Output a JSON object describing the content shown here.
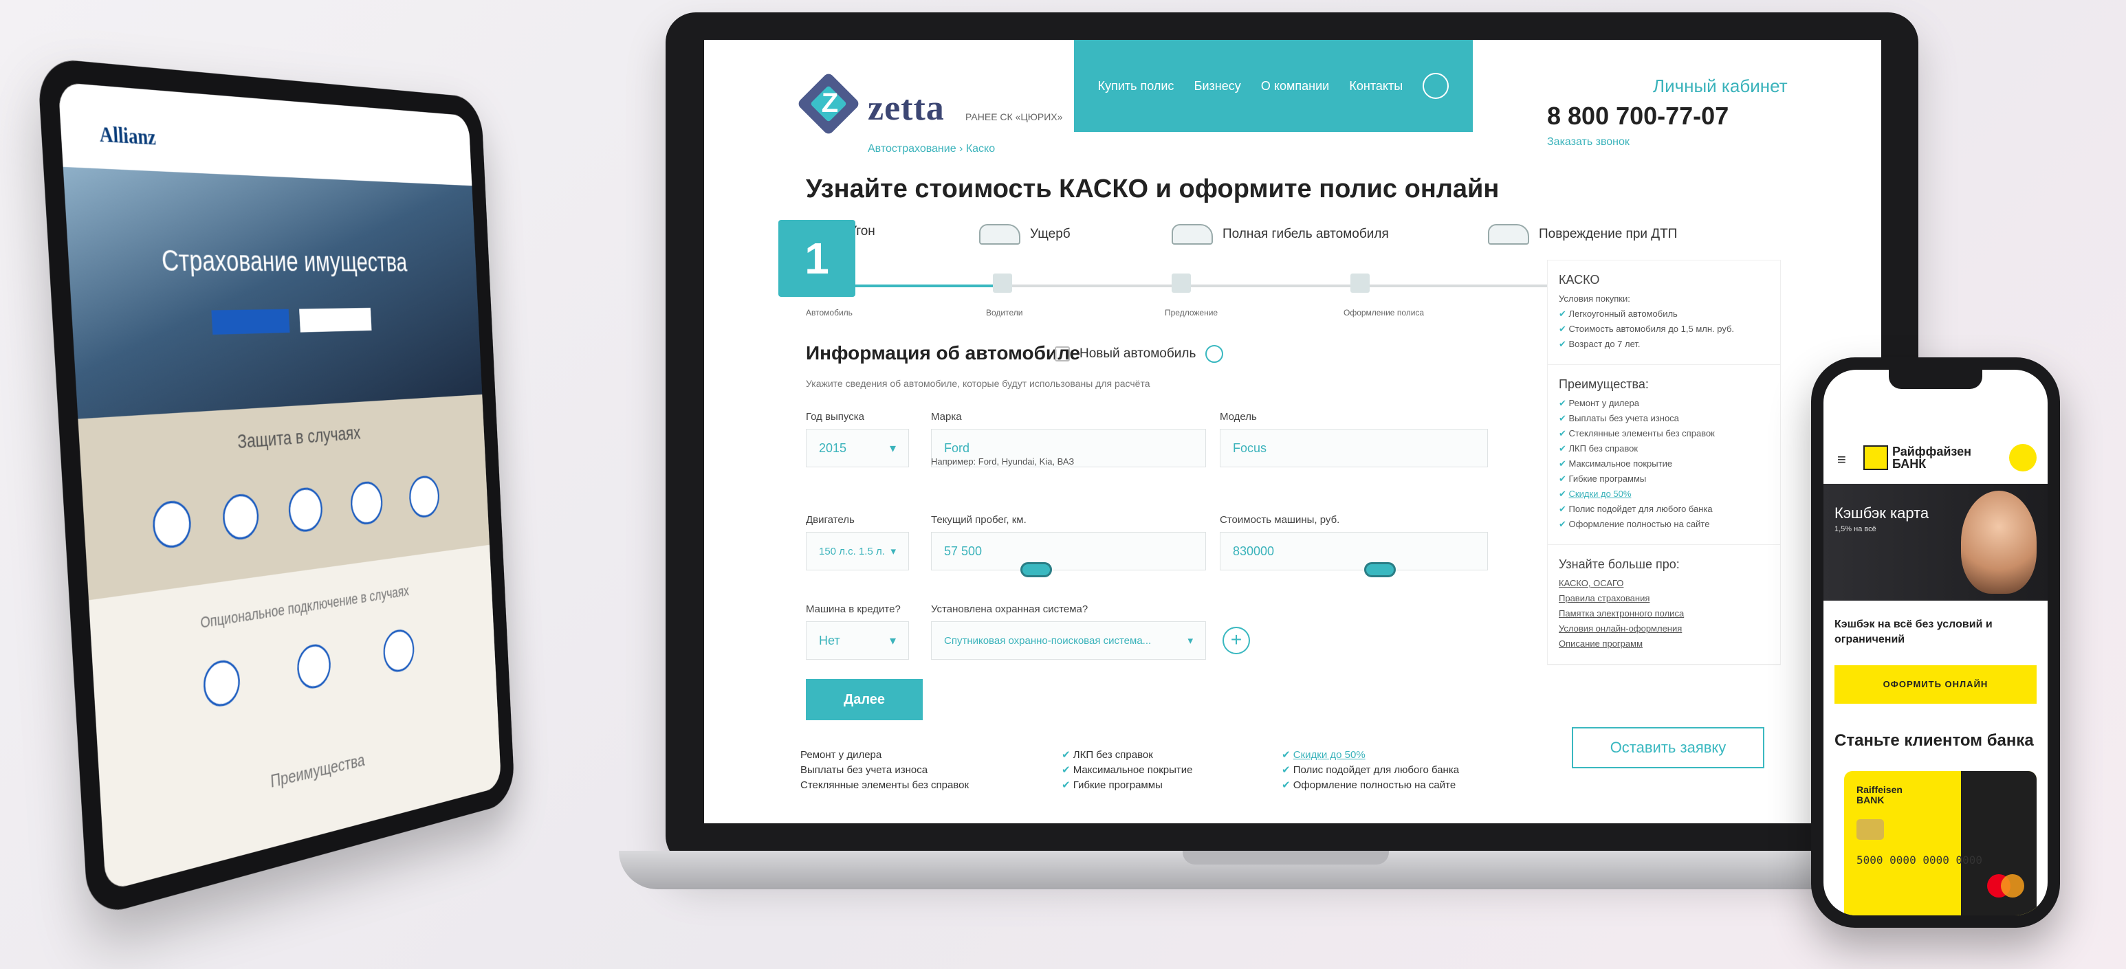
{
  "laptop": {
    "brand": "zetta",
    "brand_sub": "РАНЕЕ СК «ЦЮРИХ»",
    "logo_letter": "Z",
    "nav": [
      "Купить полис",
      "Бизнесу",
      "О компании",
      "Контакты"
    ],
    "cabinet": "Личный кабинет",
    "phone": "8 800 700-77-07",
    "callback": "Заказать звонок",
    "breadcrumbs": "Автострахование  ›  Каско",
    "page_title": "Узнайте стоимость КАСКО и оформите полис онлайн",
    "categories": [
      "Угон",
      "Ущерб",
      "Полная гибель автомобиля",
      "Повреждение при ДТП"
    ],
    "step_number": "1",
    "steps": [
      "Автомобиль",
      "Водители",
      "Предложение",
      "Оформление полиса"
    ],
    "section_title": "Информация об автомобиле",
    "new_car": "Новый автомобиль",
    "hint": "Укажите сведения об автомобиле, которые будут использованы для расчёта",
    "fields": {
      "year_label": "Год выпуска",
      "year_value": "2015",
      "brand_label": "Марка",
      "brand_value": "Ford",
      "model_label": "Модель",
      "model_value": "Focus",
      "example": "Например: Ford, Hyundai, Kia, ВАЗ",
      "engine_label": "Двигатель",
      "engine_value": "150 л.с. 1.5 л.",
      "mileage_label": "Текущий пробег, км.",
      "mileage_value": "57 500",
      "price_label": "Стоимость машины, руб.",
      "price_value": "830000",
      "credit_label": "Машина в кредите?",
      "credit_value": "Нет",
      "alarm_label": "Установлена охранная система?",
      "alarm_value": "Спутниковая охранно-поисковая система..."
    },
    "next_button": "Далее",
    "bottom_col1": [
      "Ремонт у дилера",
      "Выплаты без учета износа",
      "Стеклянные элементы без справок"
    ],
    "bottom_col2": [
      "ЛКП без справок",
      "Максимальное покрытие",
      "Гибкие программы"
    ],
    "bottom_col3": [
      "Скидки до 50%",
      "Полис подойдет для любого банка",
      "Оформление полностью на сайте"
    ],
    "sidebar": {
      "kasko_title": "КАСКО",
      "kasko_sub": "Условия покупки:",
      "kasko_items": [
        "Легкоугонный автомобиль",
        "Стоимость автомобиля до 1,5 млн. руб.",
        "Возраст до 7 лет."
      ],
      "adv_title": "Преимущества:",
      "adv_items": [
        "Ремонт у дилера",
        "Выплаты без учета износа",
        "Стеклянные элементы без справок",
        "ЛКП без справок",
        "Максимальное покрытие",
        "Гибкие программы",
        "Скидки до 50%",
        "Полис подойдет для любого банка",
        "Оформление полностью на сайте"
      ],
      "more_title": "Узнайте больше про:",
      "more_items": [
        "КАСКО, ОСАГО",
        "Правила страхования",
        "Памятка электронного полиса",
        "Условия онлайн-оформления",
        "Описание программ"
      ]
    },
    "apply_button": "Оставить заявку"
  },
  "tablet": {
    "logo": "Allianz",
    "hero_title": "Страхование имущества",
    "section1_title": "Защита в случаях",
    "section2_title": "Опциональное подключение в случаях",
    "advantages_title": "Преимущества"
  },
  "phone": {
    "bank_name": "Райффайзен БАНК",
    "hero_title": "Кэшбэк карта",
    "hero_sub": "1,5% на всё",
    "description": "Кэшбэк на всё без условий и ограничений",
    "button": "ОФОРМИТЬ ОНЛАЙН",
    "client_title": "Станьте клиентом банка",
    "card_bank": "Raiffeisen BANK",
    "card_number": "5000 0000 0000 0000"
  }
}
